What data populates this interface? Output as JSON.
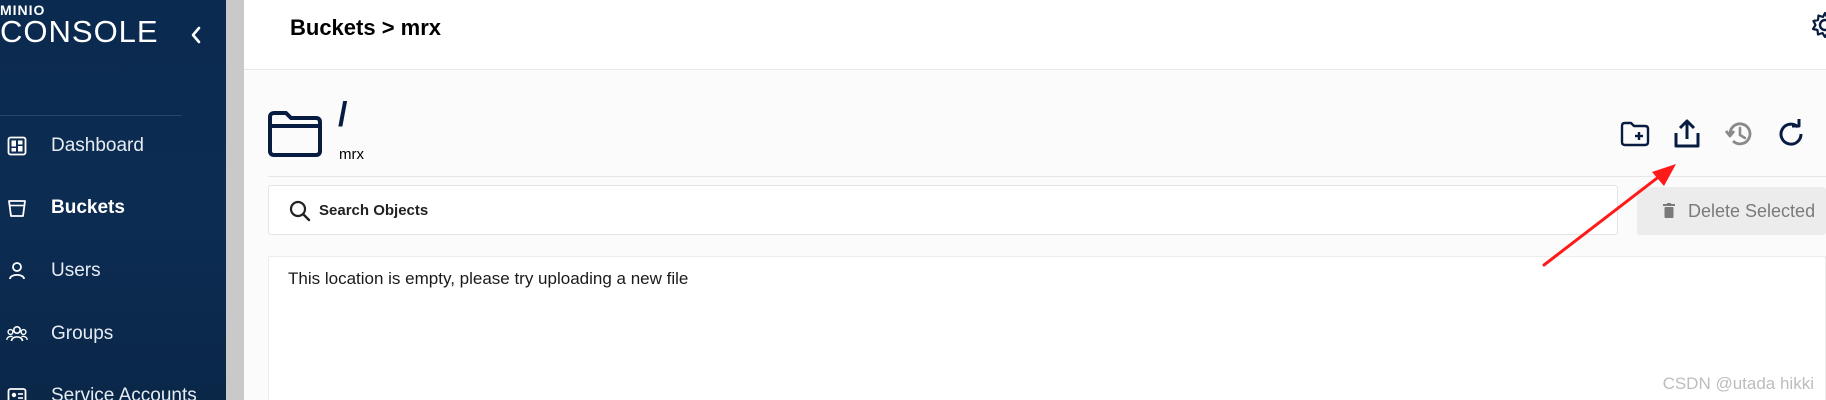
{
  "sidebar": {
    "logo_small": "MINIO",
    "logo_big": "CONSOLE",
    "items": [
      {
        "label": "Dashboard",
        "icon": "dashboard-icon"
      },
      {
        "label": "Buckets",
        "icon": "bucket-icon",
        "active": true
      },
      {
        "label": "Users",
        "icon": "user-icon"
      },
      {
        "label": "Groups",
        "icon": "groups-icon"
      },
      {
        "label": "Service Accounts",
        "icon": "service-accounts-icon"
      }
    ]
  },
  "header": {
    "breadcrumb": "Buckets > mrx"
  },
  "main": {
    "path": "/",
    "bucket": "mrx",
    "actions": [
      "create-folder-icon",
      "upload-icon",
      "rewind-icon",
      "refresh-icon"
    ],
    "search": {
      "placeholder": "Search Objects"
    },
    "delete_button": "Delete Selected",
    "empty_message": "This location is empty, please try uploading a new file"
  },
  "colors": {
    "sidebar_bg": "#0d2c52",
    "accent_dark": "#081c42",
    "annotation_arrow": "#ff1a1a"
  },
  "watermark": "CSDN @utada hikki"
}
